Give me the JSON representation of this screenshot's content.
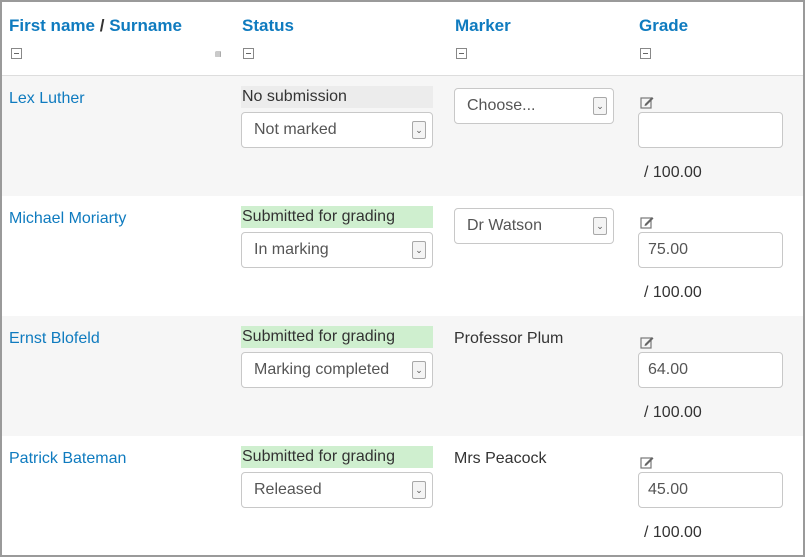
{
  "header": {
    "firstname": "First name",
    "separator": "/",
    "surname": "Surname",
    "status": "Status",
    "marker": "Marker",
    "grade": "Grade"
  },
  "rows": [
    {
      "name": "Lex Luther",
      "status_label": "No submission",
      "status_type": "none",
      "marking_workflow": "Not marked",
      "marker_mode": "select",
      "marker": "Choose...",
      "grade": "",
      "grade_max": "/ 100.00"
    },
    {
      "name": "Michael Moriarty",
      "status_label": "Submitted for grading",
      "status_type": "submitted",
      "marking_workflow": "In marking",
      "marker_mode": "select",
      "marker": "Dr Watson",
      "grade": "75.00",
      "grade_max": "/ 100.00"
    },
    {
      "name": "Ernst Blofeld",
      "status_label": "Submitted for grading",
      "status_type": "submitted",
      "marking_workflow": "Marking completed",
      "marker_mode": "text",
      "marker": "Professor Plum",
      "grade": "64.00",
      "grade_max": "/ 100.00"
    },
    {
      "name": "Patrick Bateman",
      "status_label": "Submitted for grading",
      "status_type": "submitted",
      "marking_workflow": "Released",
      "marker_mode": "text",
      "marker": "Mrs Peacock",
      "grade": "45.00",
      "grade_max": "/ 100.00"
    }
  ],
  "icons": {
    "collapse": "minus-box-icon",
    "edit": "pencil-edit-icon",
    "dropdown": "chevron-down-icon"
  },
  "colors": {
    "link": "#0f7bbf",
    "submitted_bg": "#cfefcf",
    "no_submission_bg": "#ececec",
    "alt_row_bg": "#f6f6f6"
  }
}
